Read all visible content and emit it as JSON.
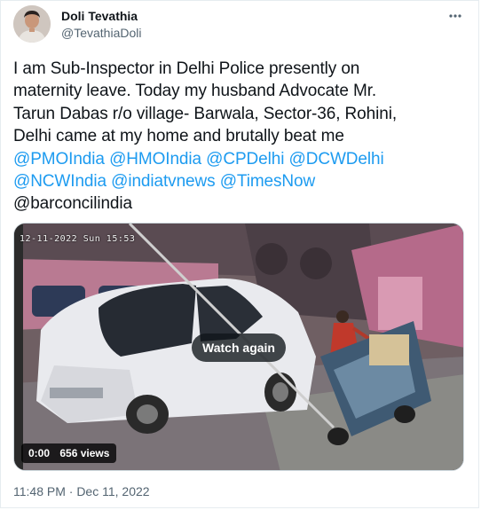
{
  "author": {
    "display_name": "Doli Tevathia",
    "handle": "@TevathiaDoli",
    "avatar_icon": "user-avatar"
  },
  "more_icon": "more-horizontal-icon",
  "tweet": {
    "line1": "I am Sub-Inspector in Delhi Police presently on",
    "line2": "maternity leave. Today my husband Advocate Mr.",
    "line3": "Tarun Dabas r/o village- Barwala, Sector-36, Rohini,",
    "line4": "Delhi came at my home and brutally beat me",
    "mentions_line5": [
      "@PMOIndia",
      "@HMOIndia",
      "@CPDelhi",
      "@DCWDelhi"
    ],
    "mentions_line6": [
      "@NCWIndia",
      "@indiatvnews",
      "@TimesNow"
    ],
    "line7": "@barconcilindia"
  },
  "media": {
    "cam_overlay": "12-11-2022 Sun 15:53",
    "watch_again": "Watch again",
    "time_elapsed": "0:00",
    "views": "656 views"
  },
  "timestamp": "11:48 PM · Dec 11, 2022",
  "colors": {
    "link": "#1d9bf0",
    "text": "#0f1419",
    "secondary": "#536471"
  }
}
